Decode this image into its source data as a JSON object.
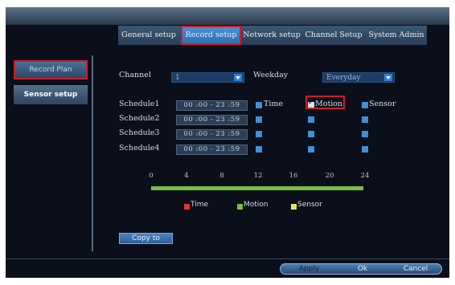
{
  "tabs": [
    {
      "label": "General setup"
    },
    {
      "label": "Record setup"
    },
    {
      "label": "Network setup"
    },
    {
      "label": "Channel Setup"
    },
    {
      "label": "System Admin"
    }
  ],
  "sidebar": {
    "items": [
      {
        "label": "Record Plan"
      },
      {
        "label": "Sensor setup"
      }
    ]
  },
  "channel": {
    "label": "Channel",
    "value": "1"
  },
  "weekday": {
    "label": "Weekday",
    "value": "Everyday"
  },
  "schedules": [
    {
      "label": "Schedule1",
      "time": "00 :00 - 23 :59"
    },
    {
      "label": "Schedule2",
      "time": "00 :00 - 23 :59"
    },
    {
      "label": "Schedule3",
      "time": "00 :00 - 23 :59"
    },
    {
      "label": "Schedule4",
      "time": "00 :00 - 23 :59"
    }
  ],
  "record_types": {
    "time": "Time",
    "motion": "Motion",
    "sensor": "Sensor"
  },
  "timeline_ticks": [
    "0",
    "4",
    "8",
    "12",
    "16",
    "20",
    "24"
  ],
  "legend": {
    "time": "Time",
    "motion": "Motion",
    "sensor": "Sensor"
  },
  "buttons": {
    "copy": "Copy to",
    "apply": "Apply",
    "ok": "Ok",
    "cancel": "Cancel"
  },
  "colors": {
    "time": "#e53030",
    "motion": "#79c045",
    "sensor": "#e8e26a",
    "highlight": "#d01c2a"
  }
}
